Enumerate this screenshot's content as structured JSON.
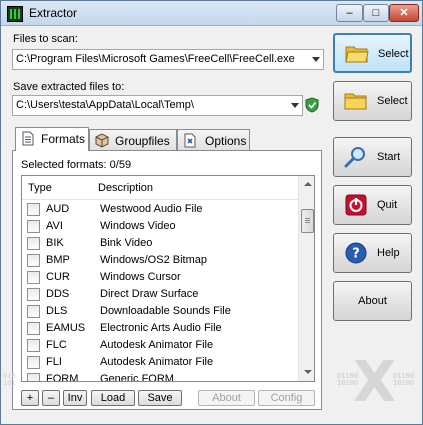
{
  "window": {
    "title": "Extractor"
  },
  "titlebar_buttons": {
    "minimize": "–",
    "maximize": "□",
    "close": "✕"
  },
  "scan": {
    "label": "Files to scan:",
    "value": "C:\\Program Files\\Microsoft Games\\FreeCell\\FreeCell.exe"
  },
  "save": {
    "label": "Save extracted files to:",
    "value": "C:\\Users\\testa\\AppData\\Local\\Temp\\"
  },
  "side_buttons": {
    "select_scan": "Select",
    "select_save": "Select",
    "start": "Start",
    "quit": "Quit",
    "help": "Help",
    "about": "About"
  },
  "tabs": [
    {
      "label": "Formats"
    },
    {
      "label": "Groupfiles"
    },
    {
      "label": "Options"
    }
  ],
  "formats": {
    "selected_label": "Selected formats: 0/59",
    "columns": {
      "type": "Type",
      "description": "Description"
    },
    "rows": [
      {
        "type": "AUD",
        "description": "Westwood Audio File"
      },
      {
        "type": "AVI",
        "description": "Windows Video"
      },
      {
        "type": "BIK",
        "description": "Bink Video"
      },
      {
        "type": "BMP",
        "description": "Windows/OS2 Bitmap"
      },
      {
        "type": "CUR",
        "description": "Windows Cursor"
      },
      {
        "type": "DDS",
        "description": "Direct Draw Surface"
      },
      {
        "type": "DLS",
        "description": "Downloadable Sounds File"
      },
      {
        "type": "EAMUS",
        "description": "Electronic Arts Audio File"
      },
      {
        "type": "FLC",
        "description": "Autodesk Animator File"
      },
      {
        "type": "FLI",
        "description": "Autodesk Animator File"
      },
      {
        "type": "FORM",
        "description": "Generic FORM"
      }
    ]
  },
  "bottom_buttons": {
    "plus": "+",
    "minus": "–",
    "inv": "Inv",
    "load": "Load",
    "save": "Save",
    "about": "About",
    "config": "Config"
  },
  "watermark": {
    "letter": "X",
    "bits_right_top": "01100\n10100",
    "bits_right_bottom": "01100\n10100",
    "bits_left": "010\n101"
  },
  "colors": {
    "focus_border": "#3c7fb1",
    "quit_red": "#c8102e",
    "help_blue": "#2a5db0",
    "folder_yellow": "#f2c94c"
  }
}
